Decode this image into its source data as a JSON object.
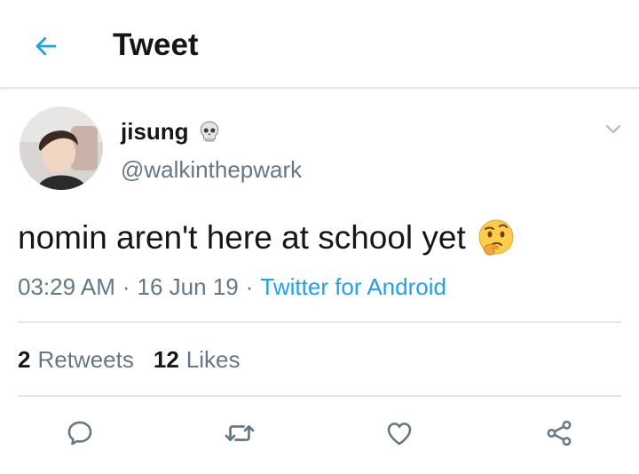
{
  "header": {
    "title": "Tweet",
    "back_icon": "arrow-left-icon",
    "accent_color": "#1da1f2"
  },
  "tweet": {
    "display_name": "jisung",
    "name_emoji": "skull-icon",
    "handle": "@walkinthepwark",
    "text": "nomin aren't here at school yet",
    "text_emoji": "thinking-face-icon",
    "time": "03:29 AM",
    "date": "16 Jun 19",
    "source": "Twitter for Android",
    "separator": "·"
  },
  "stats": {
    "retweets_count": "2",
    "retweets_label": "Retweets",
    "likes_count": "12",
    "likes_label": "Likes"
  },
  "actions": [
    "reply-icon",
    "retweet-icon",
    "like-icon",
    "share-icon"
  ],
  "colors": {
    "text_primary": "#14171a",
    "text_secondary": "#657786",
    "divider": "#e1e6ea",
    "link": "#1da1f2"
  }
}
